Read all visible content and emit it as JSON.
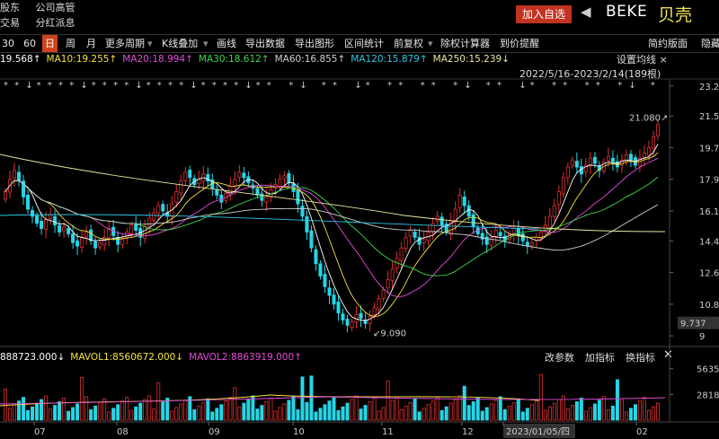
{
  "top_menu": {
    "row1": [
      "股东",
      "公司高管"
    ],
    "row2": [
      "交易",
      "分红派息"
    ]
  },
  "header": {
    "add_favorite": "加入自选",
    "ticker": "BEKE",
    "company_name": "贝壳"
  },
  "toolbar": [
    {
      "label": "30",
      "selected": false
    },
    {
      "label": "60",
      "selected": false
    },
    {
      "label": "日",
      "selected": true
    },
    {
      "label": "周",
      "selected": false
    },
    {
      "label": "月",
      "selected": false
    },
    {
      "label": "更多周期",
      "selected": false,
      "dropdown": true
    },
    {
      "label": "K线叠加",
      "selected": false,
      "dropdown": true
    },
    {
      "label": "画线",
      "selected": false
    },
    {
      "label": "导出数据",
      "selected": false
    },
    {
      "label": "导出图形",
      "selected": false
    },
    {
      "label": "区间统计",
      "selected": false
    },
    {
      "label": "前复权",
      "selected": false,
      "dropdown": true
    },
    {
      "label": "除权计算器",
      "selected": false
    },
    {
      "label": "到价提醒",
      "selected": false
    },
    {
      "label": "简约版面",
      "selected": false
    },
    {
      "label": "隐藏",
      "selected": false
    }
  ],
  "ma_legend": [
    {
      "text": "19.568↑",
      "color": "#ffffff"
    },
    {
      "text": "MA10:19.255↑",
      "color": "#f5e43b"
    },
    {
      "text": "MA20:18.994↑",
      "color": "#e44bd9"
    },
    {
      "text": "MA30:18.612↑",
      "color": "#3fd94a"
    },
    {
      "text": "MA60:16.855↑",
      "color": "#cfcfcf"
    },
    {
      "text": "MA120:15.879↑",
      "color": "#2ec6e6"
    },
    {
      "text": "MA250:15.239↓",
      "color": "#e9e6a0"
    }
  ],
  "settings_label": "设置均线",
  "date_range": "2022/5/16-2023/2/14(189根)",
  "price_axis": [
    "23.2",
    "21.5",
    "19.7",
    "17.9",
    "16.1",
    "14.4",
    "12.6",
    "10.8",
    "9"
  ],
  "current_price": "9.737",
  "annotations": {
    "high": "21.080",
    "low": "9.090"
  },
  "volume_legend": [
    {
      "text": "888723.000↓",
      "color": "#ffffff"
    },
    {
      "text": "MAVOL1:8560672.000↓",
      "color": "#f5e43b"
    },
    {
      "text": "MAVOL2:8863919.000↑",
      "color": "#e44bd9"
    }
  ],
  "volume_buttons": [
    "改参数",
    "加指标",
    "换指标"
  ],
  "volume_axis": [
    "5635",
    "2818"
  ],
  "x_axis": [
    "07",
    "08",
    "09",
    "10",
    "11",
    "12",
    "2023/01/05/四",
    "02"
  ],
  "colors": {
    "up": "#e03030",
    "down": "#26d6e6",
    "accent": "#d0421c"
  },
  "chart_data": {
    "type": "candlestick",
    "x_labels": [
      "07",
      "08",
      "09",
      "10",
      "11",
      "12",
      "2023/01/05/四",
      "02"
    ],
    "ylim": [
      9.0,
      23.2
    ],
    "high_marker": 21.08,
    "low_marker": 9.09,
    "closes": [
      17.2,
      17.9,
      18.4,
      17.8,
      16.9,
      16.2,
      15.8,
      15.4,
      15.1,
      15.6,
      15.9,
      15.3,
      14.9,
      15.2,
      14.8,
      14.3,
      14.1,
      14.6,
      14.9,
      14.4,
      14.0,
      14.3,
      14.6,
      15.1,
      14.7,
      14.2,
      14.5,
      14.9,
      15.3,
      15.0,
      14.6,
      15.2,
      15.7,
      16.0,
      16.4,
      16.1,
      15.8,
      16.5,
      17.2,
      17.8,
      18.3,
      18.0,
      17.6,
      17.9,
      18.2,
      17.8,
      17.4,
      17.0,
      16.6,
      17.1,
      17.5,
      17.9,
      18.3,
      18.0,
      17.7,
      17.4,
      17.0,
      16.7,
      16.9,
      17.3,
      17.6,
      17.9,
      18.1,
      17.7,
      17.2,
      16.5,
      15.8,
      14.9,
      14.0,
      13.1,
      12.4,
      11.8,
      11.3,
      10.8,
      10.3,
      9.9,
      9.6,
      9.8,
      10.2,
      10.0,
      9.7,
      10.1,
      10.6,
      11.1,
      11.6,
      12.2,
      12.8,
      13.4,
      14.0,
      14.6,
      15.0,
      14.6,
      14.2,
      14.5,
      14.9,
      15.4,
      15.8,
      15.3,
      14.9,
      15.5,
      16.2,
      17.0,
      16.4,
      15.8,
      15.2,
      14.8,
      14.5,
      14.2,
      14.6,
      15.0,
      14.7,
      14.4,
      14.8,
      15.1,
      14.7,
      14.4,
      14.1,
      14.3,
      14.6,
      14.9,
      15.3,
      15.8,
      16.4,
      17.2,
      18.0,
      18.6,
      19.0,
      18.6,
      18.2,
      18.7,
      19.1,
      18.8,
      18.4,
      18.9,
      19.2,
      18.9,
      18.6,
      19.0,
      19.3,
      19.0,
      18.7,
      19.1,
      19.4,
      19.7,
      20.3,
      21.0
    ],
    "volume_max": 5635,
    "volume_mid": 2818
  }
}
